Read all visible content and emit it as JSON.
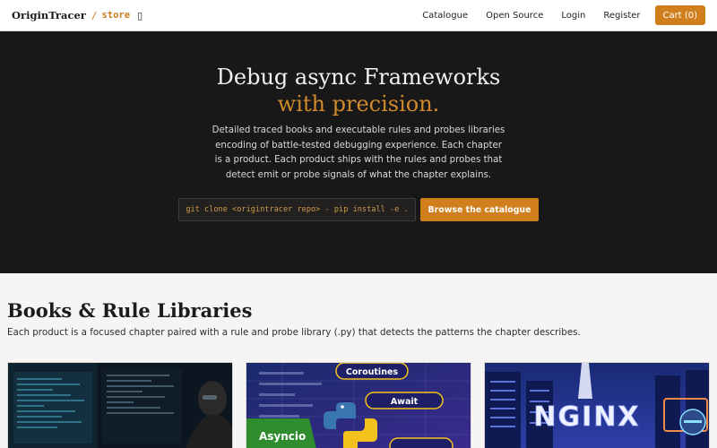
{
  "header": {
    "brand": "OriginTracer",
    "separator": "/",
    "store": "store",
    "glyph": "▯",
    "nav": [
      "Catalogue",
      "Open Source",
      "Login",
      "Register"
    ],
    "cart_label": "Cart (0)"
  },
  "hero": {
    "title": "Debug async Frameworks",
    "accent": "with precision.",
    "description": "Detailed traced books and executable rules and probes libraries encoding of battle-tested debugging experience. Each chapter is a product. Each product ships with the rules and probes that detect emit or probe signals of what the chapter explains.",
    "command": "git clone <origintracer repo>  -  pip install -e .",
    "cta_label": "Browse the catalogue"
  },
  "catalogue": {
    "title": "Books & Rule Libraries",
    "subtitle": "Each product is a focused chapter paired with a rule and probe library (.py) that detects the patterns the chapter describes.",
    "cards": [
      {
        "image_tags": []
      },
      {
        "image_tags": [
          "Coroutines",
          "Await",
          "Asyncio"
        ]
      },
      {
        "image_tags": [
          "NGINX"
        ]
      }
    ]
  },
  "colors": {
    "accent": "#d07f1c",
    "hero_bg": "#181818",
    "page_bg": "#f6f5f3"
  }
}
